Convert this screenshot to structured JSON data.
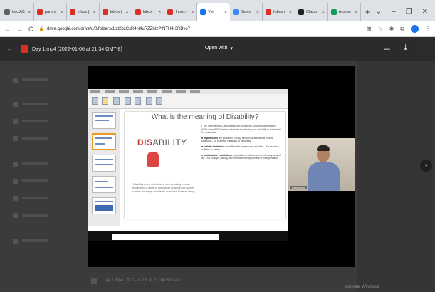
{
  "browser": {
    "tabs": [
      {
        "label": "Lec AC:",
        "color": "#5f6368"
      },
      {
        "label": "parem",
        "color": "#d93025"
      },
      {
        "label": "Inbox (",
        "color": "#d93025"
      },
      {
        "label": "Inbox (",
        "color": "#d93025"
      },
      {
        "label": "Inbox (",
        "color": "#d93025"
      },
      {
        "label": "Inbox (",
        "color": "#d93025"
      },
      {
        "label": "Vie",
        "color": "#1a73e8",
        "active": true
      },
      {
        "label": "Sides",
        "color": "#4285f4"
      },
      {
        "label": "Inbox (",
        "color": "#d93025"
      },
      {
        "label": "Classr",
        "color": "#202124"
      },
      {
        "label": "Acader",
        "color": "#0f9d58"
      }
    ],
    "new_tab": "+",
    "url": "drive.google.com/drive/u/0/folders/1tzl2bzCsR4N4uRZZhIzPfNTH4-3RByo7",
    "window_controls": [
      "⌄",
      "–",
      "❐",
      "✕"
    ]
  },
  "viewer": {
    "file_title": "Day 1.mp4 (2022-01-06 at 21:34 GMT-8)",
    "open_with": "Open with",
    "actions": [
      "＋",
      "⤓",
      "⋮"
    ]
  },
  "slide": {
    "title": "What is the meaning of Disability?",
    "logo_word": "ABILITY",
    "logo_prefix": "DIS",
    "left_text": "• Disability is any restriction or lack (resulting from an impairment) of ability to perform an activity in the manner or within the range considered normal for a human being.",
    "right_items": [
      {
        "lead": "",
        "text": "The International Classification of Functioning, Disability and Health (ICF) of the WHO define as follows: functioning and disability in context of the individual."
      },
      {
        "lead": "Impairments",
        "text": "are problems in body function or alterations in body structure – for example, paralysis or blindness;"
      },
      {
        "lead": "activity limitations",
        "text": "are difficulties in executing activities – for example, walking or eating;"
      },
      {
        "lead": "participation restrictions",
        "text": "are problems with involvement in any area of life – for example, facing discrimination in employment or transportation."
      }
    ]
  },
  "webcam": {
    "name": "Participant"
  },
  "bottom_file": {
    "label": "Day 1.mp4 (2022-01-06 at 21:34 GMT-8)"
  },
  "watermark": "Activate Windows",
  "next_icon": "›"
}
